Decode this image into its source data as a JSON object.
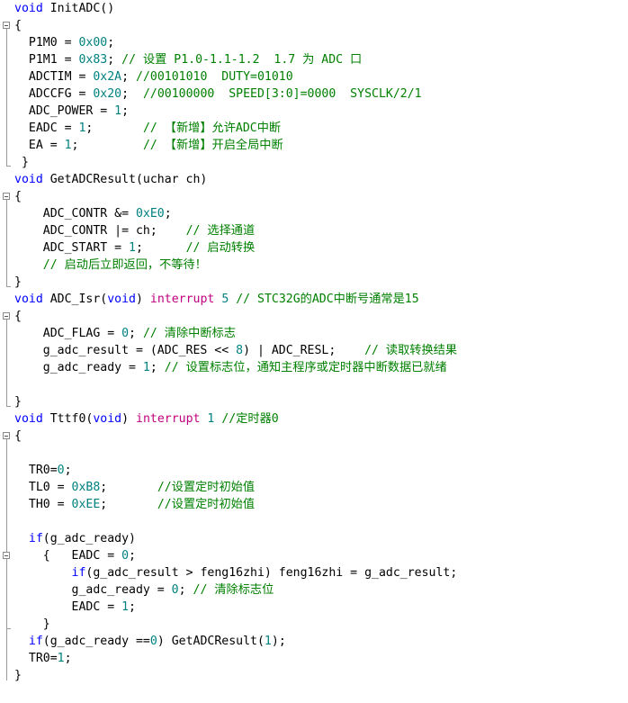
{
  "editor": {
    "language": "c",
    "colors": {
      "background": "#ffffff",
      "keyword": "#0000ff",
      "interrupt_keyword": "#c0007f",
      "number": "#008080",
      "comment": "#008000",
      "text": "#000000",
      "fold_marker": "#8a8a8a"
    },
    "lines": [
      [
        {
          "t": "void",
          "c": "kw"
        },
        {
          "t": " InitADC()",
          "c": "pl"
        }
      ],
      [
        {
          "t": "{",
          "c": "pl"
        }
      ],
      [
        {
          "t": "  P1M0 = ",
          "c": "pl"
        },
        {
          "t": "0x00",
          "c": "num"
        },
        {
          "t": ";",
          "c": "pl"
        }
      ],
      [
        {
          "t": "  P1M1 = ",
          "c": "pl"
        },
        {
          "t": "0x83",
          "c": "num"
        },
        {
          "t": "; ",
          "c": "pl"
        },
        {
          "t": "// 设置 P1.0-1.1-1.2  1.7 为 ADC 口",
          "c": "cm"
        }
      ],
      [
        {
          "t": "  ADCTIM = ",
          "c": "pl"
        },
        {
          "t": "0x2A",
          "c": "num"
        },
        {
          "t": "; ",
          "c": "pl"
        },
        {
          "t": "//00101010  DUTY=01010",
          "c": "cm"
        }
      ],
      [
        {
          "t": "  ADCCFG = ",
          "c": "pl"
        },
        {
          "t": "0x20",
          "c": "num"
        },
        {
          "t": ";  ",
          "c": "pl"
        },
        {
          "t": "//00100000  SPEED[3:0]=0000  SYSCLK/2/1",
          "c": "cm"
        }
      ],
      [
        {
          "t": "  ADC_POWER = ",
          "c": "pl"
        },
        {
          "t": "1",
          "c": "num"
        },
        {
          "t": ";",
          "c": "pl"
        }
      ],
      [
        {
          "t": "  EADC = ",
          "c": "pl"
        },
        {
          "t": "1",
          "c": "num"
        },
        {
          "t": ";       ",
          "c": "pl"
        },
        {
          "t": "// 【新增】允许ADC中断",
          "c": "cm"
        }
      ],
      [
        {
          "t": "  EA = ",
          "c": "pl"
        },
        {
          "t": "1",
          "c": "num"
        },
        {
          "t": ";         ",
          "c": "pl"
        },
        {
          "t": "// 【新增】开启全局中断",
          "c": "cm"
        }
      ],
      [
        {
          "t": " }",
          "c": "pl"
        }
      ],
      [
        {
          "t": "void",
          "c": "kw"
        },
        {
          "t": " GetADCResult(uchar ch)",
          "c": "pl"
        }
      ],
      [
        {
          "t": "{",
          "c": "pl"
        }
      ],
      [
        {
          "t": "    ADC_CONTR &= ",
          "c": "pl"
        },
        {
          "t": "0xE0",
          "c": "num"
        },
        {
          "t": ";",
          "c": "pl"
        }
      ],
      [
        {
          "t": "    ADC_CONTR |= ch;    ",
          "c": "pl"
        },
        {
          "t": "// 选择通道",
          "c": "cm"
        }
      ],
      [
        {
          "t": "    ADC_START = ",
          "c": "pl"
        },
        {
          "t": "1",
          "c": "num"
        },
        {
          "t": ";      ",
          "c": "pl"
        },
        {
          "t": "// 启动转换",
          "c": "cm"
        }
      ],
      [
        {
          "t": "    ",
          "c": "pl"
        },
        {
          "t": "// 启动后立即返回，不等待！",
          "c": "cm"
        }
      ],
      [
        {
          "t": "}",
          "c": "pl"
        }
      ],
      [
        {
          "t": "void",
          "c": "kw"
        },
        {
          "t": " ADC_Isr(",
          "c": "pl"
        },
        {
          "t": "void",
          "c": "kw"
        },
        {
          "t": ") ",
          "c": "pl"
        },
        {
          "t": "interrupt",
          "c": "int"
        },
        {
          "t": " ",
          "c": "pl"
        },
        {
          "t": "5",
          "c": "num"
        },
        {
          "t": " ",
          "c": "pl"
        },
        {
          "t": "// STC32G的ADC中断号通常是15",
          "c": "cm"
        }
      ],
      [
        {
          "t": "{",
          "c": "pl"
        }
      ],
      [
        {
          "t": "    ADC_FLAG = ",
          "c": "pl"
        },
        {
          "t": "0",
          "c": "num"
        },
        {
          "t": "; ",
          "c": "pl"
        },
        {
          "t": "// 清除中断标志",
          "c": "cm"
        }
      ],
      [
        {
          "t": "    g_adc_result = (ADC_RES << ",
          "c": "pl"
        },
        {
          "t": "8",
          "c": "num"
        },
        {
          "t": ") | ADC_RESL;    ",
          "c": "pl"
        },
        {
          "t": "// 读取转换结果",
          "c": "cm"
        }
      ],
      [
        {
          "t": "    g_adc_ready = ",
          "c": "pl"
        },
        {
          "t": "1",
          "c": "num"
        },
        {
          "t": "; ",
          "c": "pl"
        },
        {
          "t": "// 设置标志位，通知主程序或定时器中断数据已就绪",
          "c": "cm"
        }
      ],
      [
        {
          "t": "",
          "c": "pl"
        }
      ],
      [
        {
          "t": "}",
          "c": "pl"
        }
      ],
      [
        {
          "t": "void",
          "c": "kw"
        },
        {
          "t": " Tttf0(",
          "c": "pl"
        },
        {
          "t": "void",
          "c": "kw"
        },
        {
          "t": ") ",
          "c": "pl"
        },
        {
          "t": "interrupt",
          "c": "int"
        },
        {
          "t": " ",
          "c": "pl"
        },
        {
          "t": "1",
          "c": "num"
        },
        {
          "t": " ",
          "c": "pl"
        },
        {
          "t": "//定时器0",
          "c": "cm"
        }
      ],
      [
        {
          "t": "{",
          "c": "pl"
        }
      ],
      [
        {
          "t": "",
          "c": "pl"
        }
      ],
      [
        {
          "t": "  TR0=",
          "c": "pl"
        },
        {
          "t": "0",
          "c": "num"
        },
        {
          "t": ";",
          "c": "pl"
        }
      ],
      [
        {
          "t": "  TL0 = ",
          "c": "pl"
        },
        {
          "t": "0xB8",
          "c": "num"
        },
        {
          "t": ";       ",
          "c": "pl"
        },
        {
          "t": "//设置定时初始值",
          "c": "cm"
        }
      ],
      [
        {
          "t": "  TH0 = ",
          "c": "pl"
        },
        {
          "t": "0xEE",
          "c": "num"
        },
        {
          "t": ";       ",
          "c": "pl"
        },
        {
          "t": "//设置定时初始值",
          "c": "cm"
        }
      ],
      [
        {
          "t": "",
          "c": "pl"
        }
      ],
      [
        {
          "t": "  ",
          "c": "pl"
        },
        {
          "t": "if",
          "c": "kw"
        },
        {
          "t": "(g_adc_ready)",
          "c": "pl"
        }
      ],
      [
        {
          "t": "    {   EADC = ",
          "c": "pl"
        },
        {
          "t": "0",
          "c": "num"
        },
        {
          "t": ";",
          "c": "pl"
        }
      ],
      [
        {
          "t": "        ",
          "c": "pl"
        },
        {
          "t": "if",
          "c": "kw"
        },
        {
          "t": "(g_adc_result > feng16zhi) feng16zhi = g_adc_result;",
          "c": "pl"
        }
      ],
      [
        {
          "t": "        g_adc_ready = ",
          "c": "pl"
        },
        {
          "t": "0",
          "c": "num"
        },
        {
          "t": "; ",
          "c": "pl"
        },
        {
          "t": "// 清除标志位",
          "c": "cm"
        }
      ],
      [
        {
          "t": "        EADC = ",
          "c": "pl"
        },
        {
          "t": "1",
          "c": "num"
        },
        {
          "t": ";",
          "c": "pl"
        }
      ],
      [
        {
          "t": "    }",
          "c": "pl"
        }
      ],
      [
        {
          "t": "  ",
          "c": "pl"
        },
        {
          "t": "if",
          "c": "kw"
        },
        {
          "t": "(g_adc_ready ==",
          "c": "pl"
        },
        {
          "t": "0",
          "c": "num"
        },
        {
          "t": ") GetADCResult(",
          "c": "pl"
        },
        {
          "t": "1",
          "c": "num"
        },
        {
          "t": ");",
          "c": "pl"
        }
      ],
      [
        {
          "t": "  TR0=",
          "c": "pl"
        },
        {
          "t": "1",
          "c": "num"
        },
        {
          "t": ";",
          "c": "pl"
        }
      ],
      [
        {
          "t": "}",
          "c": "pl"
        }
      ]
    ]
  }
}
